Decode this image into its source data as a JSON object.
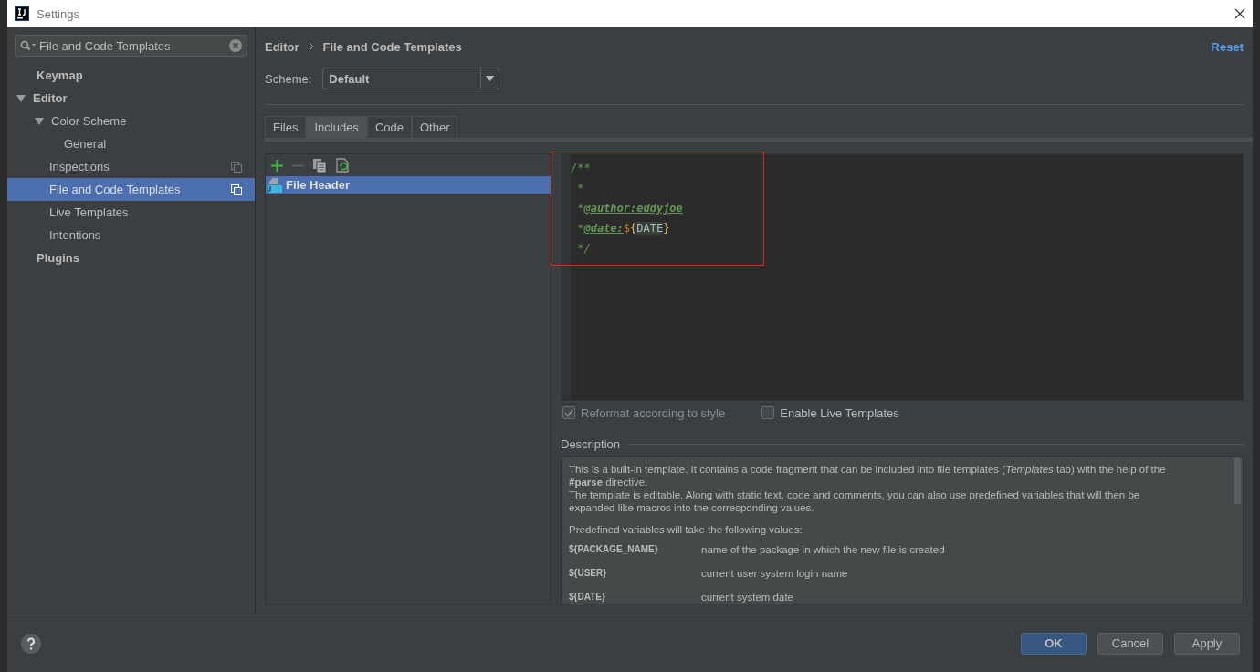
{
  "window": {
    "title": "Settings"
  },
  "search": {
    "value": "File and Code Templates"
  },
  "tree": [
    {
      "label": "Keymap",
      "selected": false
    },
    {
      "label": "Editor",
      "expanded": true,
      "selected": false,
      "children": [
        {
          "label": "Color Scheme",
          "expanded": true,
          "selected": false,
          "children": [
            {
              "label": "General",
              "selected": false
            }
          ]
        },
        {
          "label": "Inspections",
          "selected": false,
          "project_level": true
        },
        {
          "label": "File and Code Templates",
          "selected": true,
          "project_level": true
        },
        {
          "label": "Live Templates",
          "selected": false
        },
        {
          "label": "Intentions",
          "selected": false
        }
      ]
    },
    {
      "label": "Plugins",
      "selected": false
    }
  ],
  "breadcrumb": [
    "Editor",
    "File and Code Templates"
  ],
  "reset": "Reset",
  "scheme": {
    "label": "Scheme:",
    "value": "Default"
  },
  "tabs": [
    {
      "label": "Files",
      "selected": false
    },
    {
      "label": "Includes",
      "selected": true
    },
    {
      "label": "Code",
      "selected": false
    },
    {
      "label": "Other",
      "selected": false
    }
  ],
  "templates": [
    {
      "name": "File Header",
      "selected": true
    }
  ],
  "code_lines": [
    [
      {
        "kind": "comment",
        "text": "/**"
      }
    ],
    [
      {
        "kind": "comment",
        "text": " *"
      }
    ],
    [
      {
        "kind": "comment",
        "text": " *"
      },
      {
        "kind": "tag",
        "text": "@author:eddyjoe"
      }
    ],
    [
      {
        "kind": "comment",
        "text": " *"
      },
      {
        "kind": "tag",
        "text": "@date:"
      },
      {
        "kind": "dollar",
        "text": "$"
      },
      {
        "kind": "brace",
        "text": "{"
      },
      {
        "kind": "variable",
        "text": "DATE"
      },
      {
        "kind": "brace",
        "text": "}"
      }
    ],
    [
      {
        "kind": "comment",
        "text": " */"
      }
    ]
  ],
  "options": [
    {
      "label": "Reformat according to style",
      "checked": true,
      "disabled": true
    },
    {
      "label": "Enable Live Templates",
      "checked": false,
      "disabled": false
    }
  ],
  "description": {
    "title": "Description",
    "paragraphs": [
      "This is a built-in template. It contains a code fragment that can be included into file templates (*Templates* tab) with the help of the **#parse** directive.",
      "The template is editable. Along with static text, code and comments, you can also use predefined variables that will then be expanded like macros into the corresponding values."
    ],
    "variables_intro": "Predefined variables will take the following values:",
    "variables": [
      {
        "name": "${PACKAGE_NAME}",
        "meaning": "name of the package in which the new file is created"
      },
      {
        "name": "${USER}",
        "meaning": "current user system login name"
      },
      {
        "name": "${DATE}",
        "meaning": "current system date"
      }
    ]
  },
  "buttons": [
    {
      "label": "OK",
      "default": true
    },
    {
      "label": "Cancel",
      "default": false
    },
    {
      "label": "Apply",
      "default": false
    }
  ]
}
